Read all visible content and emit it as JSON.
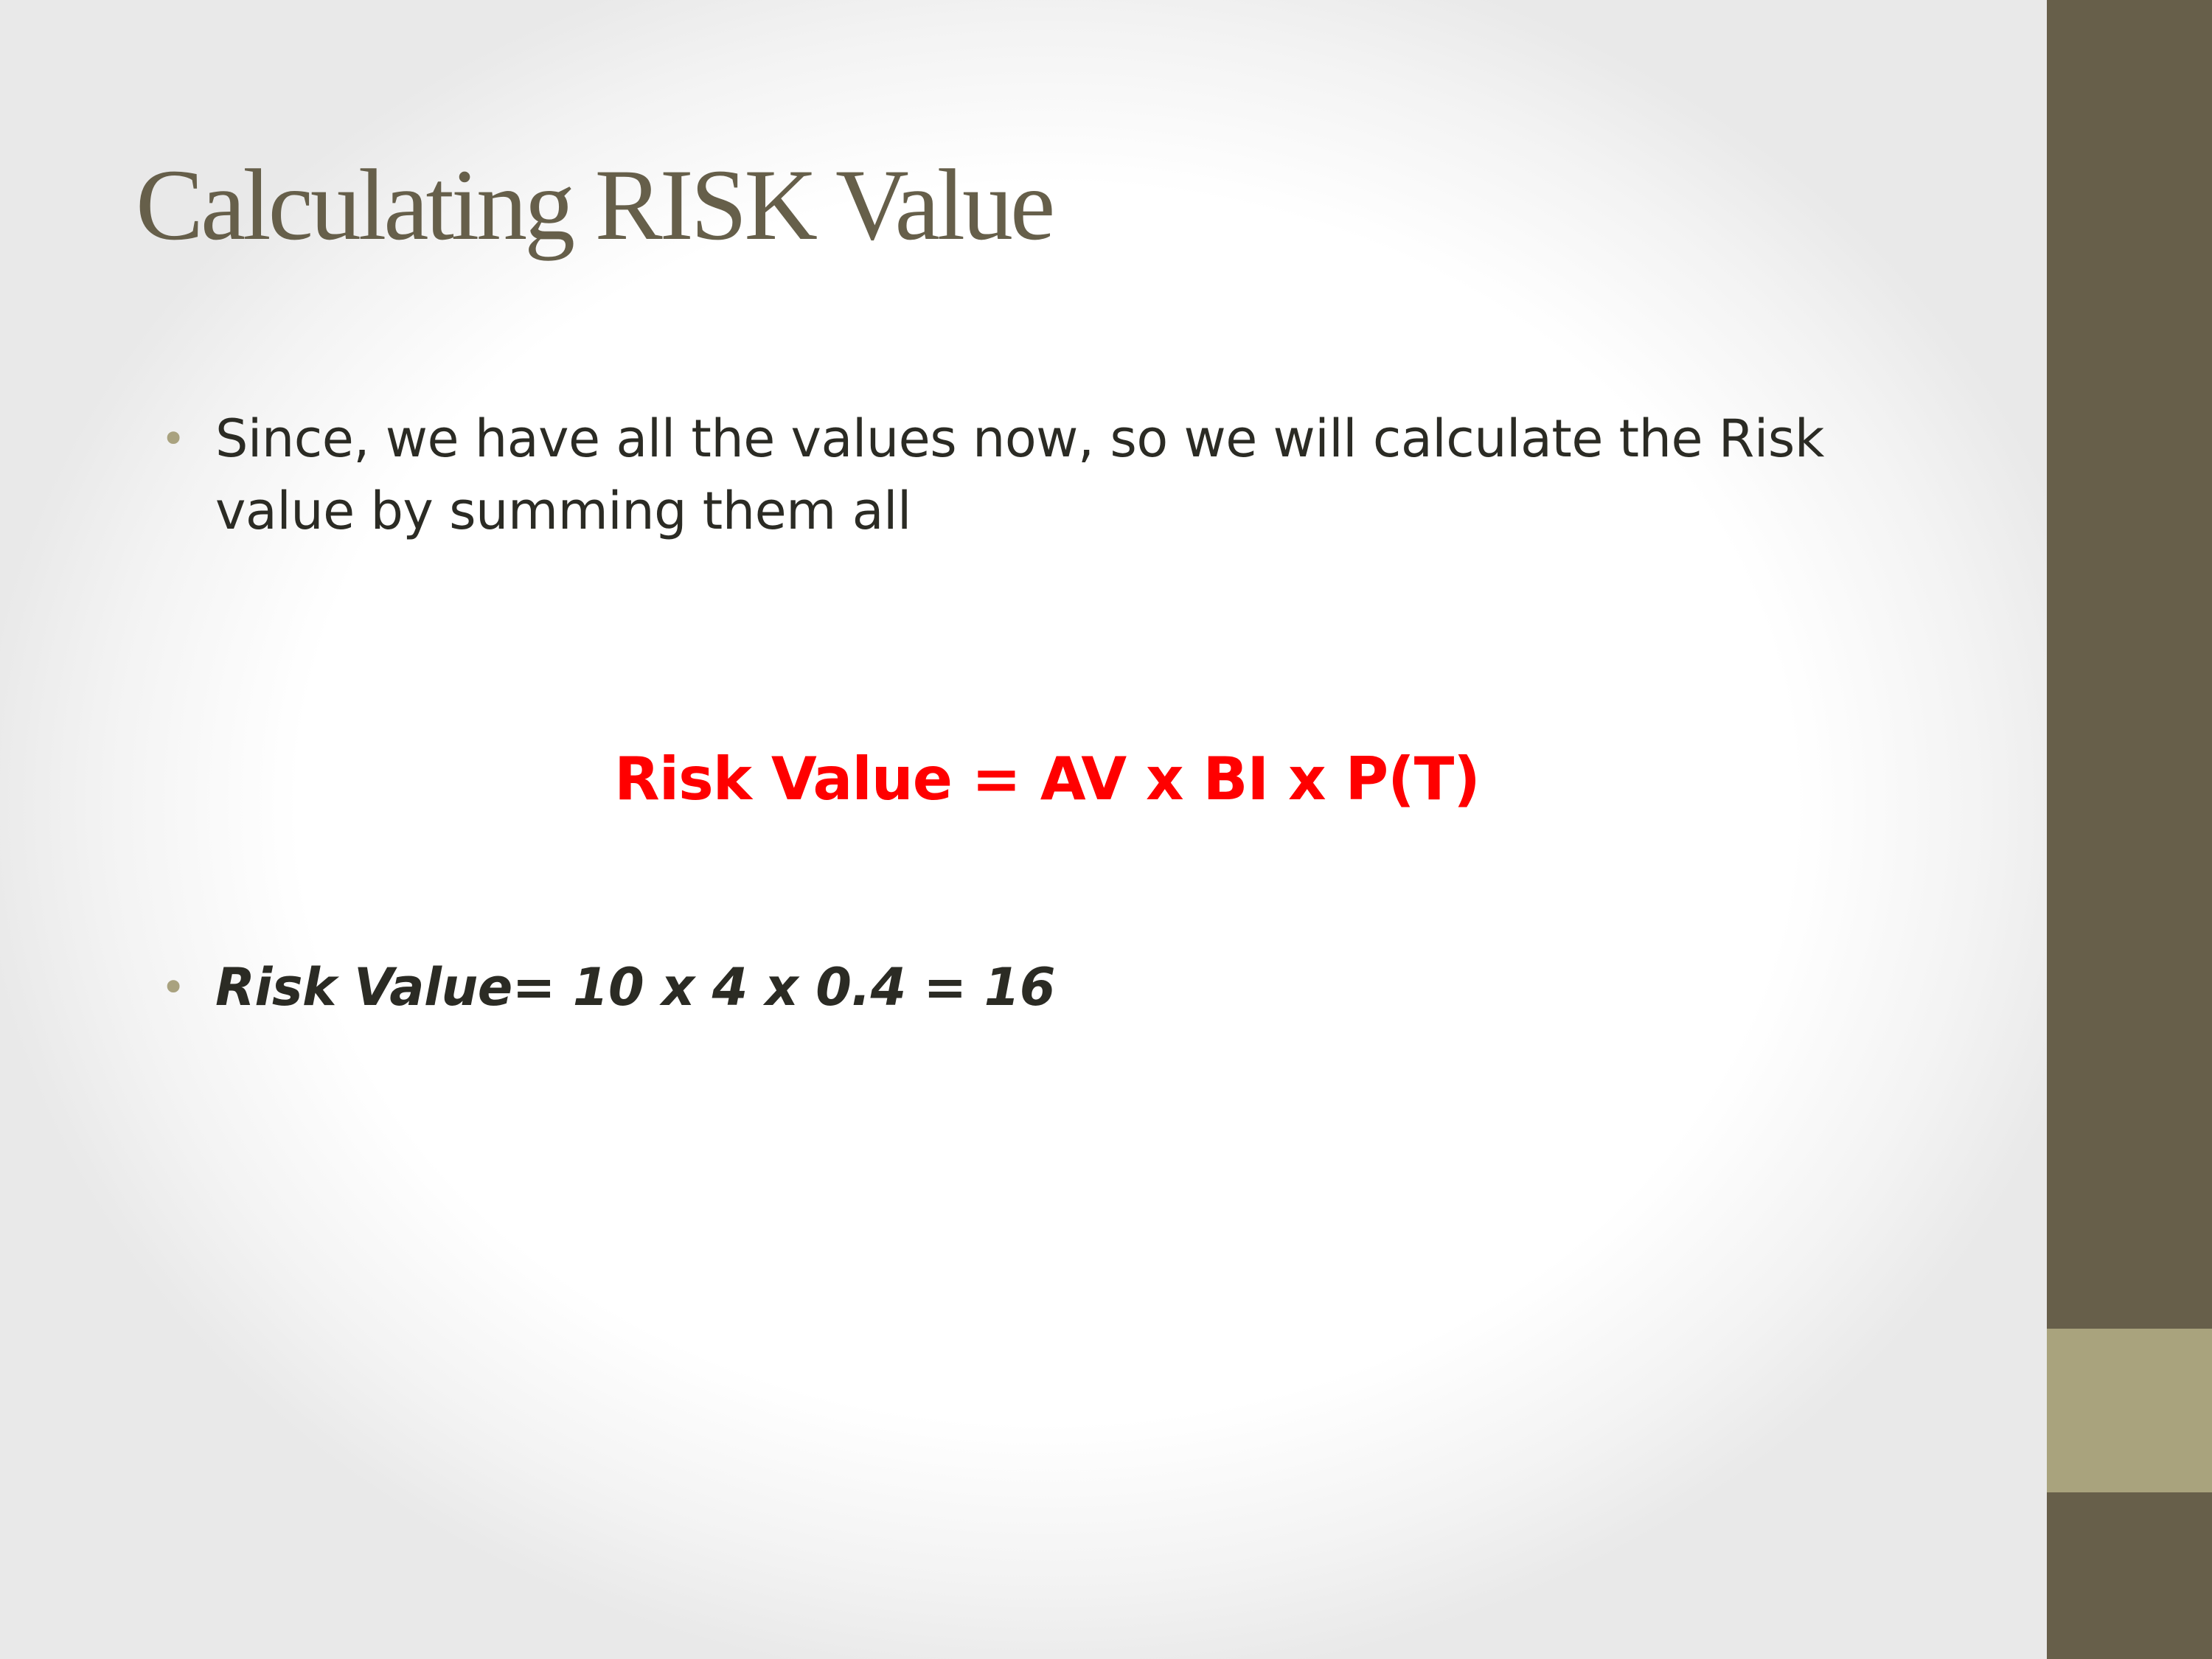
{
  "slide": {
    "title": "Calculating RISK Value",
    "bullets": [
      {
        "text": "Since, we have all the values now, so we will calculate the Risk value by summing them all"
      },
      {
        "text": "Risk Value= 10 x 4 x 0.4 = 16"
      }
    ],
    "formula": "Risk Value = AV x BI x P(T)",
    "colors": {
      "title": "#665f4a",
      "sidebar": "#675f4a",
      "sidebar_accent": "#a9a37d",
      "bullet": "#a9a27f",
      "body_text": "#2b2b24",
      "formula": "#ff0000"
    }
  }
}
